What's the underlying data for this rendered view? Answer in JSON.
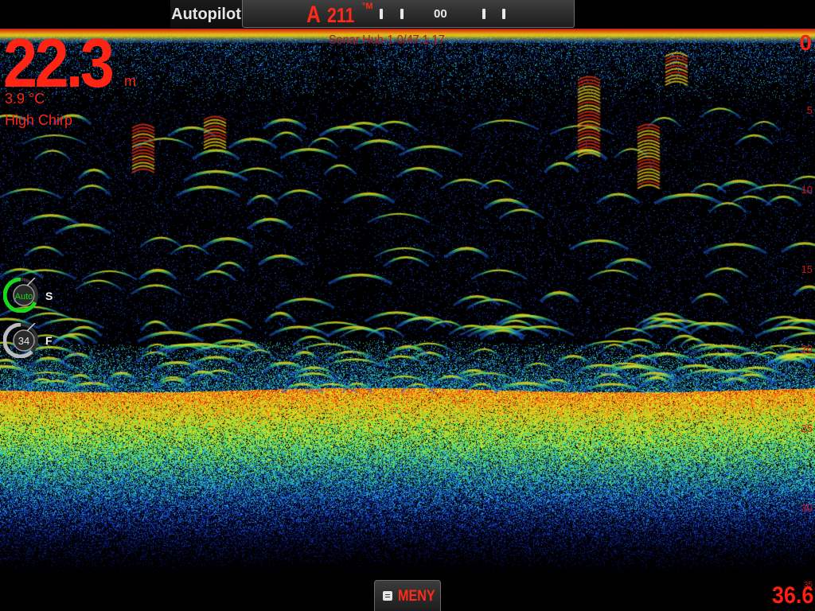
{
  "autopilot": {
    "label": "Autopilot",
    "mode": "A",
    "heading": "211",
    "heading_unit": "°M",
    "rudder": "00"
  },
  "sonar": {
    "source": "Sonar Hub-1 0/47.1.17",
    "depth": "22.3",
    "depth_unit": "m",
    "temperature": "3.9 °C",
    "frequency": "High Chirp",
    "range_max": "36.6"
  },
  "range_scale": [
    {
      "label": "0",
      "depth": 0
    },
    {
      "label": "5",
      "depth": 5
    },
    {
      "label": "10",
      "depth": 10
    },
    {
      "label": "15",
      "depth": 15
    },
    {
      "label": "20",
      "depth": 20
    },
    {
      "label": "25",
      "depth": 25
    },
    {
      "label": "30",
      "depth": 30
    },
    {
      "label": "35",
      "depth": 35
    }
  ],
  "gauges": {
    "sensitivity": {
      "value": "Auto",
      "letter": "S",
      "color": "#18d818"
    },
    "colorline": {
      "value": "34",
      "letter": "F",
      "color": "#bcbcbc"
    }
  },
  "menu": {
    "label": "MENY"
  },
  "colors": {
    "readout": "#ff2414",
    "accent": "#ff2a1a",
    "bottom_echo": "#c81010"
  }
}
